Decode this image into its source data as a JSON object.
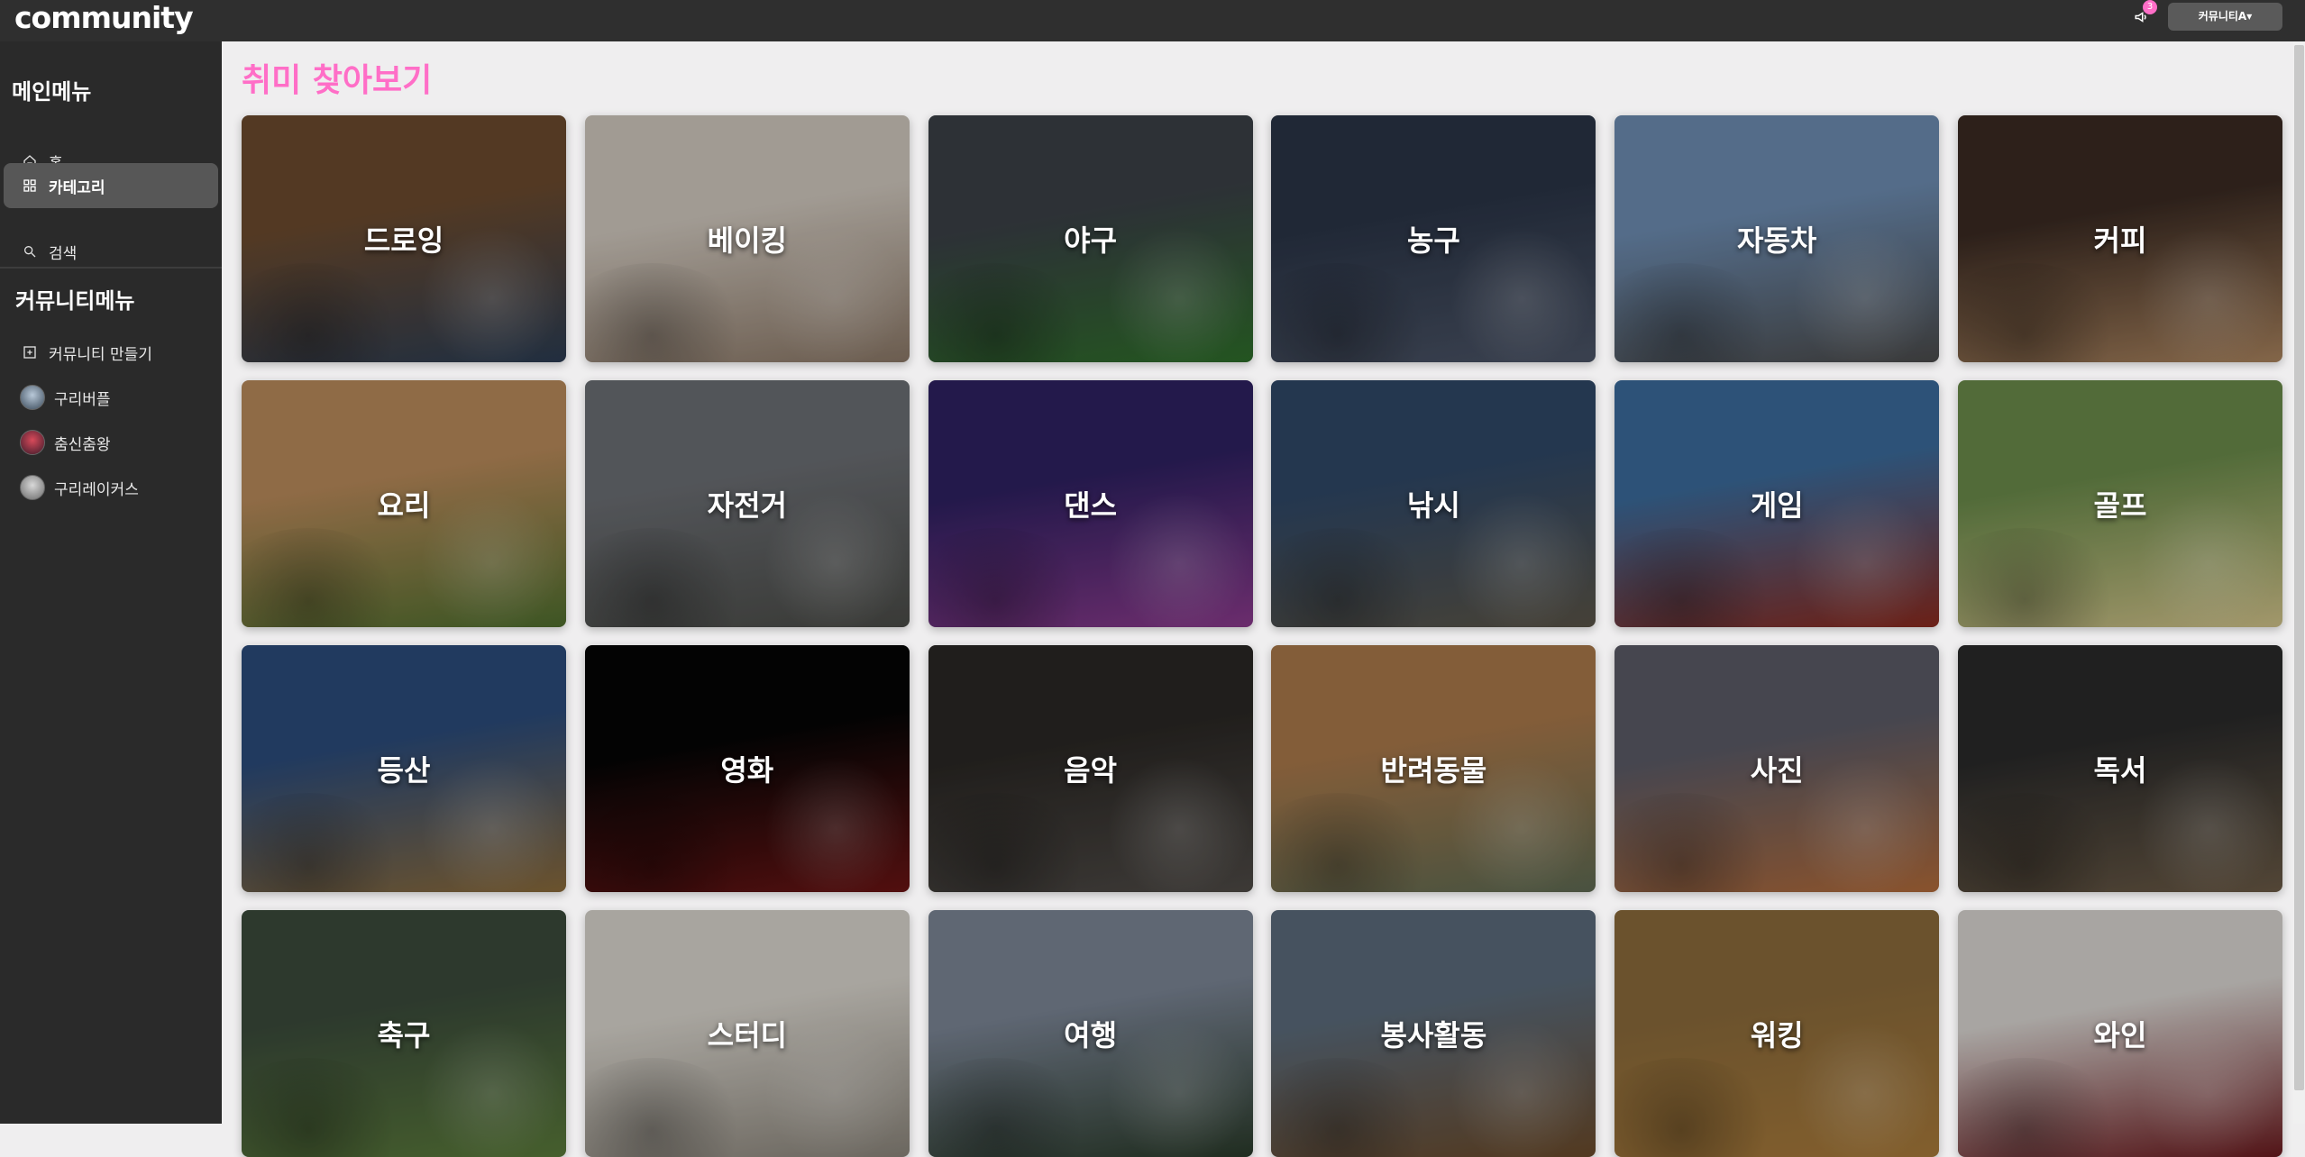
{
  "topbar": {
    "logo": "community",
    "notification_count": "3",
    "user_label": "커뮤니티A▾"
  },
  "sidebar": {
    "main_menu_title": "메인메뉴",
    "main_items": [
      {
        "label": "홈",
        "icon": "home-icon"
      },
      {
        "label": "카테고리",
        "icon": "grid-icon",
        "active": true
      },
      {
        "label": "검색",
        "icon": "search-icon"
      }
    ],
    "community_menu_title": "커뮤니티메뉴",
    "community_items": [
      {
        "label": "커뮤니티 만들기",
        "icon": "plus-square-icon"
      },
      {
        "label": "구리버플",
        "icon": "avatar"
      },
      {
        "label": "춤신춤왕",
        "icon": "avatar"
      },
      {
        "label": "구리레이커스",
        "icon": "avatar"
      }
    ]
  },
  "main": {
    "title": "취미 찾아보기",
    "categories": [
      {
        "label": "드로잉",
        "c1": "#6b4a2e",
        "c2": "#2b3c52"
      },
      {
        "label": "베이킹",
        "c1": "#cfc7bd",
        "c2": "#8a7766"
      },
      {
        "label": "야구",
        "c1": "#3a3f46",
        "c2": "#2e6d2a"
      },
      {
        "label": "농구",
        "c1": "#2a3446",
        "c2": "#4b5466"
      },
      {
        "label": "자동차",
        "c1": "#6c8bb0",
        "c2": "#4a4a4a"
      },
      {
        "label": "커피",
        "c1": "#3a2a22",
        "c2": "#a9835e"
      },
      {
        "label": "요리",
        "c1": "#b8895a",
        "c2": "#4f6e2e"
      },
      {
        "label": "자전거",
        "c1": "#6a6d72",
        "c2": "#4a4b47"
      },
      {
        "label": "댄스",
        "c1": "#2d2060",
        "c2": "#8a3a8c"
      },
      {
        "label": "낚시",
        "c1": "#2f4766",
        "c2": "#5a5447"
      },
      {
        "label": "게임",
        "c1": "#3a6a9a",
        "c2": "#8a2a1e"
      },
      {
        "label": "골프",
        "c1": "#6a8a4a",
        "c2": "#d0c28a"
      },
      {
        "label": "등산",
        "c1": "#2b4b7a",
        "c2": "#8a6a3a"
      },
      {
        "label": "영화",
        "c1": "#050505",
        "c2": "#6a1414"
      },
      {
        "label": "음악",
        "c1": "#2a2724",
        "c2": "#4e4a46"
      },
      {
        "label": "반려동물",
        "c1": "#a8784a",
        "c2": "#5e6a52"
      },
      {
        "label": "사진",
        "c1": "#5a5a66",
        "c2": "#b06a3a"
      },
      {
        "label": "독서",
        "c1": "#2a2a2a",
        "c2": "#6a5a46"
      },
      {
        "label": "축구",
        "c1": "#3a4a3a",
        "c2": "#5a7a3a"
      },
      {
        "label": "스터디",
        "c1": "#d8d4cc",
        "c2": "#8a847a"
      },
      {
        "label": "여행",
        "c1": "#7a8494",
        "c2": "#2a3a2a"
      },
      {
        "label": "봉사활동",
        "c1": "#5a6a7a",
        "c2": "#6a4a2a"
      },
      {
        "label": "워킹",
        "c1": "#8a6a3a",
        "c2": "#a87a3a"
      },
      {
        "label": "와인",
        "c1": "#d8d4d0",
        "c2": "#6a1a1e"
      }
    ]
  },
  "colors": {
    "accent": "#ff6ec7",
    "topbar_bg": "#2f2f2f",
    "sidebar_bg": "#2a2a2a",
    "active_item_bg": "#575757",
    "page_bg": "#efeeef"
  }
}
